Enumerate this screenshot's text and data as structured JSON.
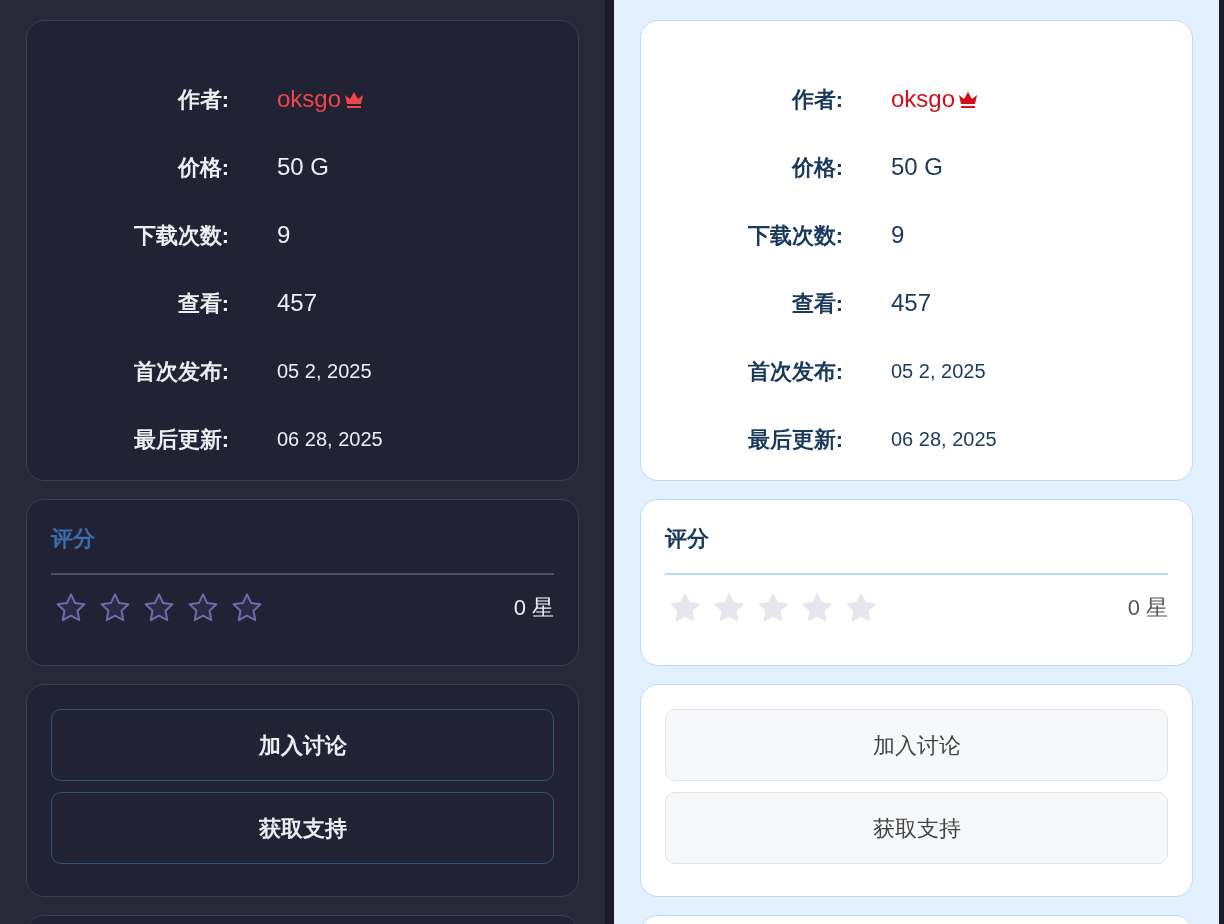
{
  "panels": [
    {
      "kind": "dark",
      "details": [
        {
          "label": "作者:",
          "value": "oksgo",
          "kind": "author"
        },
        {
          "label": "价格:",
          "value": "50 G",
          "kind": "number"
        },
        {
          "label": "下载次数:",
          "value": "9",
          "kind": "number"
        },
        {
          "label": "查看:",
          "value": "457",
          "kind": "number"
        },
        {
          "label": "首次发布:",
          "value": "05 2, 2025",
          "kind": "date"
        },
        {
          "label": "最后更新:",
          "value": "06 28, 2025",
          "kind": "date"
        }
      ],
      "rating": {
        "title": "评分",
        "stars": 0,
        "reading": "0 星"
      },
      "buttons": [
        "加入讨论",
        "获取支持"
      ]
    },
    {
      "kind": "light",
      "details": [
        {
          "label": "作者:",
          "value": "oksgo",
          "kind": "author"
        },
        {
          "label": "价格:",
          "value": "50 G",
          "kind": "number"
        },
        {
          "label": "下载次数:",
          "value": "9",
          "kind": "number"
        },
        {
          "label": "查看:",
          "value": "457",
          "kind": "number"
        },
        {
          "label": "首次发布:",
          "value": "05 2, 2025",
          "kind": "date"
        },
        {
          "label": "最后更新:",
          "value": "06 28, 2025",
          "kind": "date"
        }
      ],
      "rating": {
        "title": "评分",
        "stars": 0,
        "reading": "0 星"
      },
      "buttons": [
        "加入讨论",
        "获取支持"
      ]
    }
  ]
}
